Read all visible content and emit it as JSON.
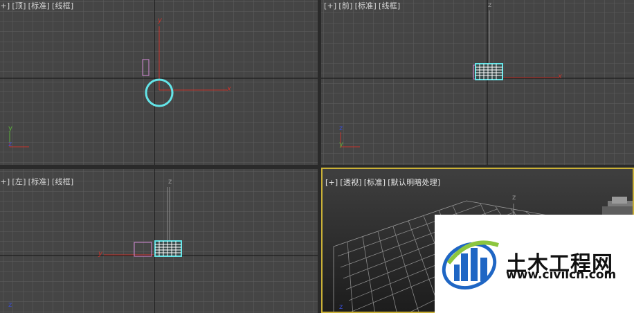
{
  "viewports": {
    "top": {
      "plus": "[+]",
      "view": "[顶]",
      "shading": "[标准]",
      "mode": "[线框]"
    },
    "front": {
      "plus": "[+]",
      "view": "[前]",
      "shading": "[标准]",
      "mode": "[线框]"
    },
    "left": {
      "plus": "[+]",
      "view": "[左]",
      "shading": "[标准]",
      "mode": "[线框]"
    },
    "perspective": {
      "plus": "[+]",
      "view": "[透视]",
      "shading": "[标准]",
      "mode": "[默认明暗处理]"
    }
  },
  "axes": {
    "x": "x",
    "y": "y",
    "z": "z"
  },
  "watermark": {
    "title": "土木工程网",
    "url": "www.civilcn.com"
  },
  "colors": {
    "viewport_bg": "#454545",
    "grid": "#5f5f5f",
    "origin_line": "#1a1a1a",
    "active_border": "#c9b037",
    "selection": "#63e5e8",
    "axis_x": "#c8342c",
    "axis_y": "#5ab03c",
    "axis_z": "#3a4ed0",
    "light_object": "#d58ad8"
  }
}
